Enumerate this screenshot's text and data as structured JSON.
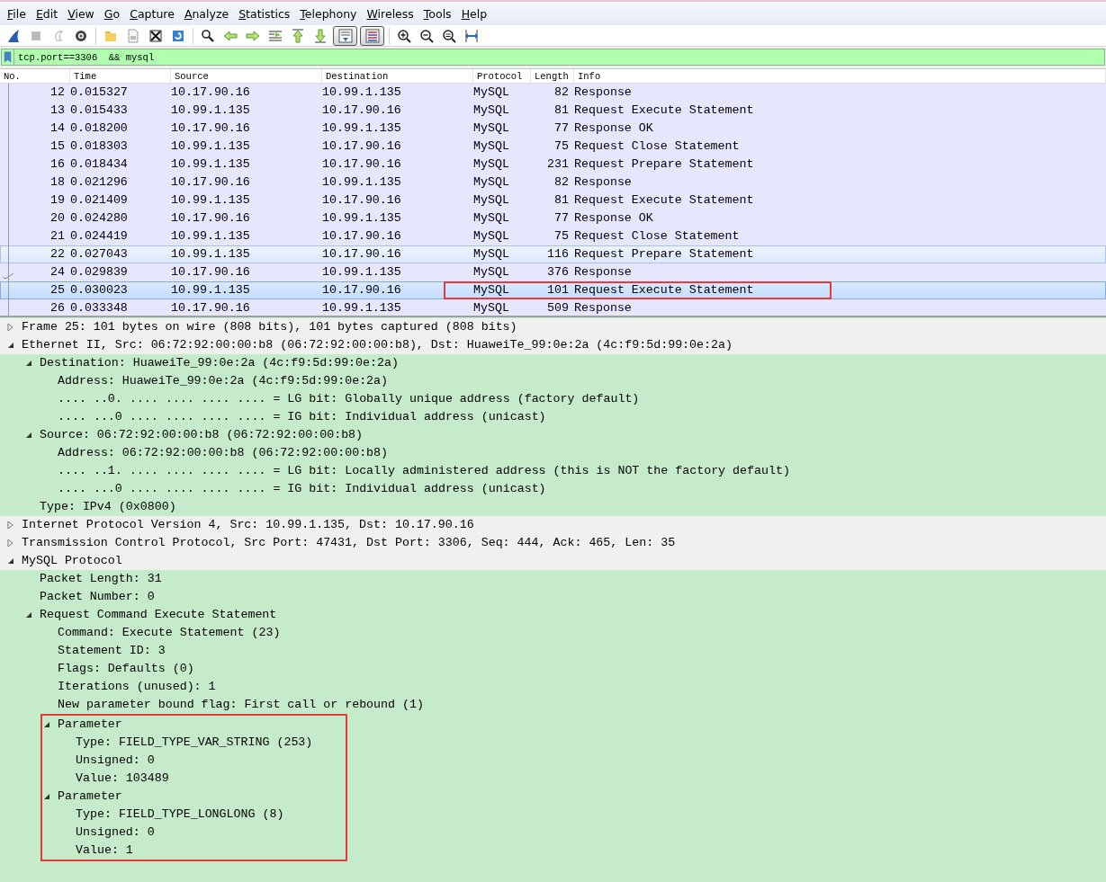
{
  "menu": [
    "File",
    "Edit",
    "View",
    "Go",
    "Capture",
    "Analyze",
    "Statistics",
    "Telephony",
    "Wireless",
    "Tools",
    "Help"
  ],
  "toolbar": [
    {
      "pressed": false,
      "disabled": false
    },
    {
      "pressed": false,
      "disabled": true
    },
    {
      "pressed": false,
      "disabled": true
    },
    {
      "pressed": false,
      "disabled": false
    },
    {
      "pressed": false,
      "disabled": false
    },
    {
      "pressed": false,
      "disabled": false
    },
    {
      "pressed": false,
      "disabled": false
    },
    {
      "pressed": false,
      "disabled": false
    },
    {
      "pressed": false,
      "disabled": false
    },
    {
      "pressed": false,
      "disabled": false
    },
    {
      "pressed": false,
      "disabled": false
    },
    {
      "pressed": false,
      "disabled": false
    },
    {
      "pressed": false,
      "disabled": false
    },
    {
      "pressed": false,
      "disabled": false
    },
    {
      "pressed": true,
      "disabled": false
    },
    {
      "pressed": true,
      "disabled": false
    },
    {
      "pressed": false,
      "disabled": false
    },
    {
      "pressed": false,
      "disabled": false
    },
    {
      "pressed": false,
      "disabled": false
    },
    {
      "pressed": false,
      "disabled": false
    }
  ],
  "filter": {
    "value": "tcp.port==3306  && mysql"
  },
  "packet_list": {
    "columns": [
      "No.",
      "Time",
      "Source",
      "Destination",
      "Protocol",
      "Length",
      "Info"
    ],
    "rows": [
      {
        "cells": [
          "12",
          "0.015327",
          "10.17.90.16",
          "10.99.1.135",
          "MySQL",
          "82",
          "Response"
        ],
        "selected": false,
        "hovered": false,
        "acked": false,
        "annotated": false
      },
      {
        "cells": [
          "13",
          "0.015433",
          "10.99.1.135",
          "10.17.90.16",
          "MySQL",
          "81",
          "Request Execute Statement"
        ],
        "selected": false,
        "hovered": false,
        "acked": false,
        "annotated": false
      },
      {
        "cells": [
          "14",
          "0.018200",
          "10.17.90.16",
          "10.99.1.135",
          "MySQL",
          "77",
          "Response OK"
        ],
        "selected": false,
        "hovered": false,
        "acked": false,
        "annotated": false
      },
      {
        "cells": [
          "15",
          "0.018303",
          "10.99.1.135",
          "10.17.90.16",
          "MySQL",
          "75",
          "Request Close Statement"
        ],
        "selected": false,
        "hovered": false,
        "acked": false,
        "annotated": false
      },
      {
        "cells": [
          "16",
          "0.018434",
          "10.99.1.135",
          "10.17.90.16",
          "MySQL",
          "231",
          "Request Prepare Statement"
        ],
        "selected": false,
        "hovered": false,
        "acked": false,
        "annotated": false
      },
      {
        "cells": [
          "18",
          "0.021296",
          "10.17.90.16",
          "10.99.1.135",
          "MySQL",
          "82",
          "Response"
        ],
        "selected": false,
        "hovered": false,
        "acked": false,
        "annotated": false
      },
      {
        "cells": [
          "19",
          "0.021409",
          "10.99.1.135",
          "10.17.90.16",
          "MySQL",
          "81",
          "Request Execute Statement"
        ],
        "selected": false,
        "hovered": false,
        "acked": false,
        "annotated": false
      },
      {
        "cells": [
          "20",
          "0.024280",
          "10.17.90.16",
          "10.99.1.135",
          "MySQL",
          "77",
          "Response OK"
        ],
        "selected": false,
        "hovered": false,
        "acked": false,
        "annotated": false
      },
      {
        "cells": [
          "21",
          "0.024419",
          "10.99.1.135",
          "10.17.90.16",
          "MySQL",
          "75",
          "Request Close Statement"
        ],
        "selected": false,
        "hovered": false,
        "acked": false,
        "annotated": false
      },
      {
        "cells": [
          "22",
          "0.027043",
          "10.99.1.135",
          "10.17.90.16",
          "MySQL",
          "116",
          "Request Prepare Statement"
        ],
        "selected": false,
        "hovered": true,
        "acked": false,
        "annotated": false
      },
      {
        "cells": [
          "24",
          "0.029839",
          "10.17.90.16",
          "10.99.1.135",
          "MySQL",
          "376",
          "Response"
        ],
        "selected": false,
        "hovered": false,
        "acked": true,
        "annotated": false
      },
      {
        "cells": [
          "25",
          "0.030023",
          "10.99.1.135",
          "10.17.90.16",
          "MySQL",
          "101",
          "Request Execute Statement"
        ],
        "selected": true,
        "hovered": false,
        "acked": false,
        "annotated": true
      },
      {
        "cells": [
          "26",
          "0.033348",
          "10.17.90.16",
          "10.99.1.135",
          "MySQL",
          "509",
          "Response"
        ],
        "selected": false,
        "hovered": false,
        "acked": false,
        "annotated": false
      }
    ]
  },
  "details": [
    {
      "text": "Frame 25: 101 bytes on wire (808 bits), 101 bytes captured (808 bits)",
      "expanded": false
    },
    {
      "text": "Ethernet II, Src: 06:72:92:00:00:b8 (06:72:92:00:00:b8), Dst: HuaweiTe_99:0e:2a (4c:f9:5d:99:0e:2a)",
      "expanded": true,
      "children": [
        {
          "text": "Destination: HuaweiTe_99:0e:2a (4c:f9:5d:99:0e:2a)",
          "expanded": true,
          "children": [
            {
              "text": "Address: HuaweiTe_99:0e:2a (4c:f9:5d:99:0e:2a)"
            },
            {
              "text": ".... ..0. .... .... .... .... = LG bit: Globally unique address (factory default)"
            },
            {
              "text": ".... ...0 .... .... .... .... = IG bit: Individual address (unicast)"
            }
          ]
        },
        {
          "text": "Source: 06:72:92:00:00:b8 (06:72:92:00:00:b8)",
          "expanded": true,
          "children": [
            {
              "text": "Address: 06:72:92:00:00:b8 (06:72:92:00:00:b8)"
            },
            {
              "text": ".... ..1. .... .... .... .... = LG bit: Locally administered address (this is NOT the factory default)"
            },
            {
              "text": ".... ...0 .... .... .... .... = IG bit: Individual address (unicast)"
            }
          ]
        },
        {
          "text": "Type: IPv4 (0x0800)"
        }
      ]
    },
    {
      "text": "Internet Protocol Version 4, Src: 10.99.1.135, Dst: 10.17.90.16",
      "expanded": false
    },
    {
      "text": "Transmission Control Protocol, Src Port: 47431, Dst Port: 3306, Seq: 444, Ack: 465, Len: 35",
      "expanded": false
    },
    {
      "text": "MySQL Protocol",
      "expanded": true,
      "children": [
        {
          "text": "Packet Length: 31"
        },
        {
          "text": "Packet Number: 0"
        },
        {
          "text": "Request Command Execute Statement",
          "expanded": true,
          "children": [
            {
              "text": "Command: Execute Statement (23)"
            },
            {
              "text": "Statement ID: 3"
            },
            {
              "text": "Flags: Defaults (0)"
            },
            {
              "text": "Iterations (unused): 1"
            },
            {
              "text": "New parameter bound flag: First call or rebound (1)"
            },
            {
              "text": "Parameter",
              "expanded": true,
              "boxed": true,
              "children": [
                {
                  "text": "Type: FIELD_TYPE_VAR_STRING (253)"
                },
                {
                  "text": "Unsigned: 0"
                },
                {
                  "text": "Value: 103489"
                }
              ]
            },
            {
              "text": "Parameter",
              "expanded": true,
              "boxed": true,
              "children": [
                {
                  "text": "Type: FIELD_TYPE_LONGLONG (8)"
                },
                {
                  "text": "Unsigned: 0"
                },
                {
                  "text": "Value: 1"
                }
              ]
            }
          ]
        }
      ]
    }
  ]
}
